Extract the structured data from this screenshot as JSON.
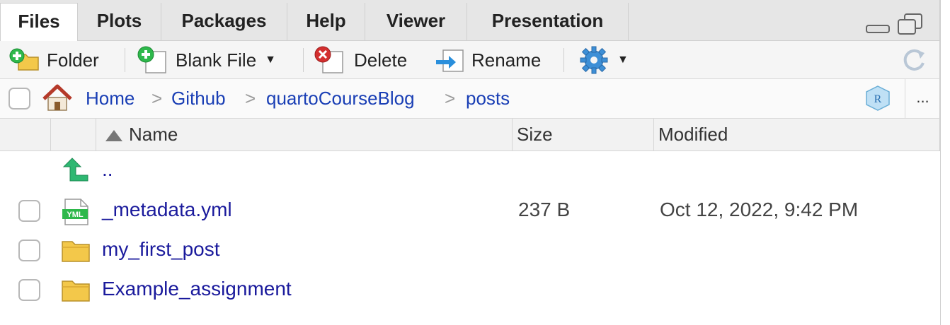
{
  "tabs": [
    {
      "label": "Files",
      "active": true
    },
    {
      "label": "Plots"
    },
    {
      "label": "Packages"
    },
    {
      "label": "Help"
    },
    {
      "label": "Viewer"
    },
    {
      "label": "Presentation"
    }
  ],
  "toolbar": {
    "new_folder_label": "Folder",
    "blank_file_label": "Blank File",
    "delete_label": "Delete",
    "rename_label": "Rename",
    "icons": {
      "new_folder": "folder-plus-icon",
      "blank_file": "file-plus-icon",
      "delete": "delete-icon",
      "rename": "rename-icon",
      "more": "gear-icon",
      "refresh": "refresh-icon"
    }
  },
  "breadcrumb": {
    "items": [
      "Home",
      "Github",
      "quartoCourseBlog",
      "posts"
    ],
    "separator": ">",
    "more_label": "..."
  },
  "columns": {
    "name": "Name",
    "size": "Size",
    "modified": "Modified",
    "sort": "ascending"
  },
  "parent_dir_label": "..",
  "files": [
    {
      "name": "_metadata.yml",
      "type": "yml",
      "size": "237 B",
      "modified": "Oct 12, 2022, 9:42 PM"
    },
    {
      "name": "my_first_post",
      "type": "folder",
      "size": "",
      "modified": ""
    },
    {
      "name": "Example_assignment",
      "type": "folder",
      "size": "",
      "modified": ""
    }
  ],
  "colors": {
    "link": "#1a3fb5",
    "file_link": "#1a1a9c",
    "tab_bg": "#e6e6e6",
    "toolbar_bg": "#f5f5f5",
    "up_arrow": "#2eb872",
    "folder": "#f3c84a",
    "delete_red": "#d32f2f",
    "gear_blue": "#3d8fd6"
  }
}
